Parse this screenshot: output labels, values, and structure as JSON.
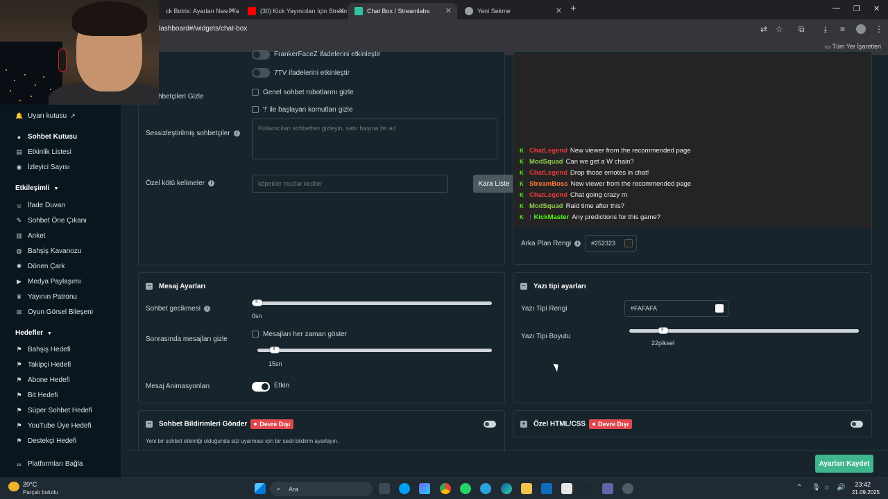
{
  "browser": {
    "tabs": [
      {
        "title": "ck Botrix: Ayarları Nasıl Ya",
        "favicon_color": "#888888"
      },
      {
        "title": "(30) Kick Yayıncıları İçin Stream",
        "favicon_color": "#ff0000"
      },
      {
        "title": "Chat Box / Streamlabs",
        "favicon_color": "#31c3a2",
        "active": true
      },
      {
        "title": "Yeni Sekme",
        "favicon_color": "#9aa0a6"
      }
    ],
    "url": "lashboard#/widgets/chat-box",
    "bookmarks_all": "Tüm Yer İşaretleri"
  },
  "sidebar": {
    "items_top": [
      {
        "label": "Uyarı kutusu",
        "icon": "bell-icon",
        "external": true
      },
      {
        "label": "Sohbet Kutusu",
        "icon": "chat-icon",
        "active": true
      },
      {
        "label": "Etkinlik Listesi",
        "icon": "list-icon"
      },
      {
        "label": "İzleyici Sayısı",
        "icon": "eye-icon"
      }
    ],
    "group_engagement": "Etkileşimli",
    "items_engagement": [
      {
        "label": "İfade Duvarı",
        "icon": "emote-icon"
      },
      {
        "label": "Sohbet Öne Çıkanı",
        "icon": "highlight-icon"
      },
      {
        "label": "Anket",
        "icon": "poll-icon"
      },
      {
        "label": "Bahşiş Kavanozu",
        "icon": "jar-icon"
      },
      {
        "label": "Dönen Çark",
        "icon": "wheel-icon"
      },
      {
        "label": "Medya Paylaşımı",
        "icon": "media-icon"
      },
      {
        "label": "Yayının Patronu",
        "icon": "crown-icon"
      },
      {
        "label": "Oyun Görsel Bileşeni",
        "icon": "game-icon"
      }
    ],
    "group_goals": "Hedefler",
    "items_goals": [
      {
        "label": "Bahşiş Hedefi",
        "icon": "goal-icon"
      },
      {
        "label": "Takipçi Hedefi",
        "icon": "goal-icon"
      },
      {
        "label": "Abone Hedefi",
        "icon": "goal-icon"
      },
      {
        "label": "Bit Hedefi",
        "icon": "goal-icon"
      },
      {
        "label": "Süper Sohbet Hedefi",
        "icon": "goal-icon"
      },
      {
        "label": "YouTube Üye Hedefi",
        "icon": "goal-icon"
      },
      {
        "label": "Destekçi Hedefi",
        "icon": "goal-icon"
      }
    ],
    "connect_platforms": "Platformları Bağla"
  },
  "chat_settings": {
    "ffz_label": "FrankerFaceZ ifadelerini etkinleştir",
    "seventv_label": "7TV ifadelerini etkinleştir",
    "hide_chatters_label": "hbetçileri Gizle",
    "hide_bots_label": "Genel sohbet robotlarını gizle",
    "hide_commands_label": "'!' ile başlayan komutları gizle",
    "muted_label": "Sessizleştirilmiş sohbetçiler",
    "muted_placeholder": "Kullanıcıları sohbetten gizleyin, satır başına bir ad",
    "badwords_label": "Özel kötü kelimeler",
    "badwords_placeholder": "köpekler muzlar kediler",
    "blacklist_button": "Kara Liste"
  },
  "preview": {
    "messages": [
      {
        "user": "ChatLegend",
        "user_color": "#e33b3b",
        "text": "New viewer from the recommended page"
      },
      {
        "user": "ModSquad",
        "user_color": "#8fd14f",
        "text": "Can we get a W chain?"
      },
      {
        "user": "ChatLegend",
        "user_color": "#e33b3b",
        "text": "Drop those emotes in chat!"
      },
      {
        "user": "StreamBoss",
        "user_color": "#ff7a3d",
        "text": "New viewer from the recommended page"
      },
      {
        "user": "ChatLegend",
        "user_color": "#e33b3b",
        "text": "Chat going crazy rn"
      },
      {
        "user": "ModSquad",
        "user_color": "#8fd14f",
        "text": "Raid time after this?"
      },
      {
        "user": "KickMaster",
        "user_color": "#53fc18",
        "text": "Any predictions for this game?"
      }
    ],
    "bg_color_label": "Arka Plan Rengi",
    "bg_color_value": "#252323",
    "bg_swatch": "#252323"
  },
  "message_settings": {
    "title": "Mesaj Ayarları",
    "delay_label": "Sohbet gecikmesi",
    "delay_value": "0sn",
    "delay_level": 0,
    "hide_after_label": "Sonrasında mesajları gizle",
    "always_show_label": "Mesajları her zaman göster",
    "hide_after_value": "15sn",
    "hide_after_level": 0.07,
    "animation_label": "Mesaj Animasyonları",
    "animation_value": "Etkin"
  },
  "font_settings": {
    "title": "Yazı tipi ayarları",
    "color_label": "Yazı Tipi Rengi",
    "color_value": "#FAFAFA",
    "color_swatch": "#FAFAFA",
    "size_label": "Yazı Tipi Boyutu",
    "size_value": "22piksel",
    "size_level": 0.15
  },
  "notifications": {
    "title": "Sohbet Bildirimleri Gönder",
    "status": "Devre Dışı",
    "description": "Yeni bir sohbet etkinliği olduğunda sizi uyarması için bir sesli bildirim ayarlayın."
  },
  "custom_css": {
    "title": "Özel HTML/CSS",
    "status": "Devre Dışı"
  },
  "save_button": "Ayarları Kaydet",
  "taskbar": {
    "weather_temp": "20°C",
    "weather_desc": "Parçalı bulutlu",
    "search_label": "Ara",
    "time": "23:42",
    "date": "21.09.2025"
  }
}
